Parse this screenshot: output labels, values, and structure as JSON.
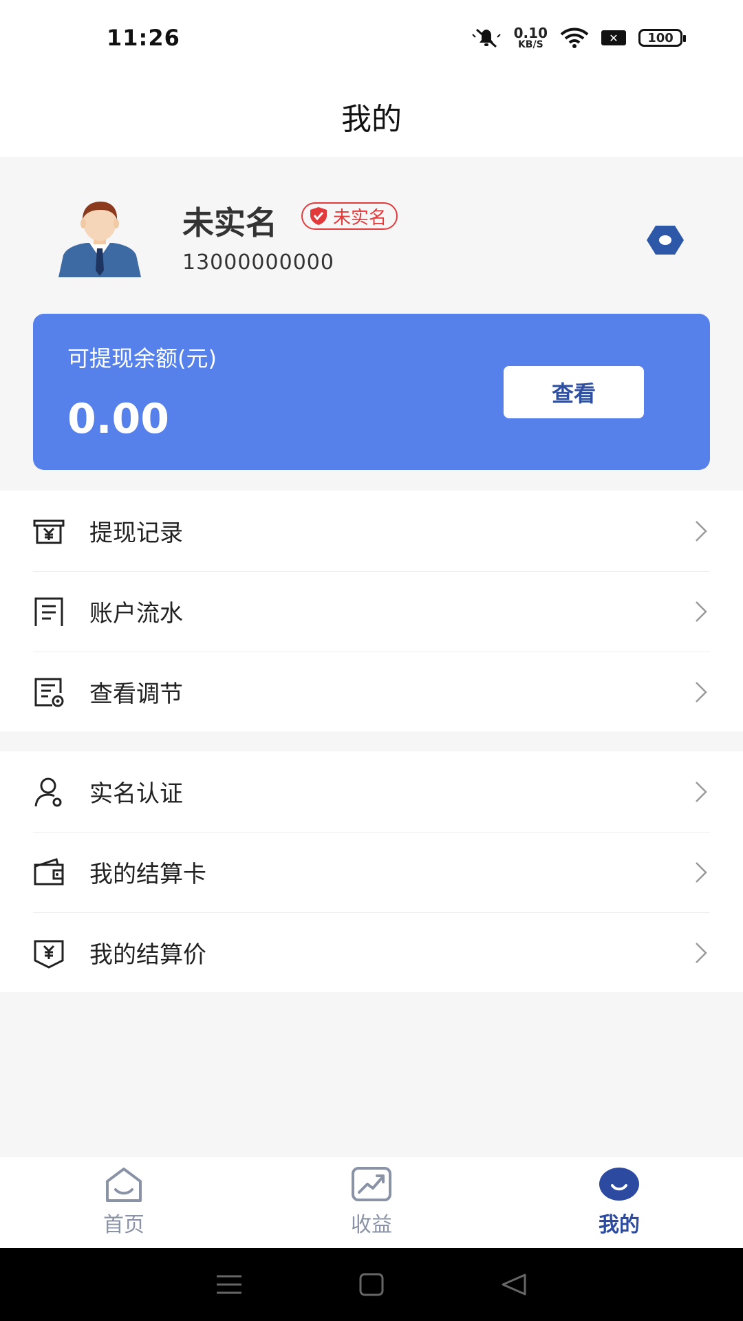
{
  "status_bar": {
    "time": "11:26",
    "net_speed_value": "0.10",
    "net_speed_unit": "KB/S",
    "battery": "100"
  },
  "header": {
    "title": "我的"
  },
  "profile": {
    "name": "未实名",
    "verify_badge": "未实名",
    "phone": "13000000000"
  },
  "balance": {
    "label": "可提现余额(元)",
    "value": "0.00",
    "view_button": "查看"
  },
  "menu_group_1": [
    {
      "label": "提现记录",
      "icon": "withdraw-record-icon"
    },
    {
      "label": "账户流水",
      "icon": "account-flow-icon"
    },
    {
      "label": "查看调节",
      "icon": "adjust-view-icon"
    }
  ],
  "menu_group_2": [
    {
      "label": "实名认证",
      "icon": "user-verify-icon"
    },
    {
      "label": "我的结算卡",
      "icon": "wallet-card-icon"
    },
    {
      "label": "我的结算价",
      "icon": "settlement-price-icon"
    }
  ],
  "tabs": [
    {
      "label": "首页",
      "icon": "home-icon",
      "active": false
    },
    {
      "label": "收益",
      "icon": "earnings-chart-icon",
      "active": false
    },
    {
      "label": "我的",
      "icon": "profile-smile-icon",
      "active": true
    }
  ],
  "colors": {
    "card_blue": "#5680ea",
    "active_tab": "#2b4aa0",
    "inactive_tab": "#8a93a6",
    "badge_red": "#e23a3a"
  }
}
